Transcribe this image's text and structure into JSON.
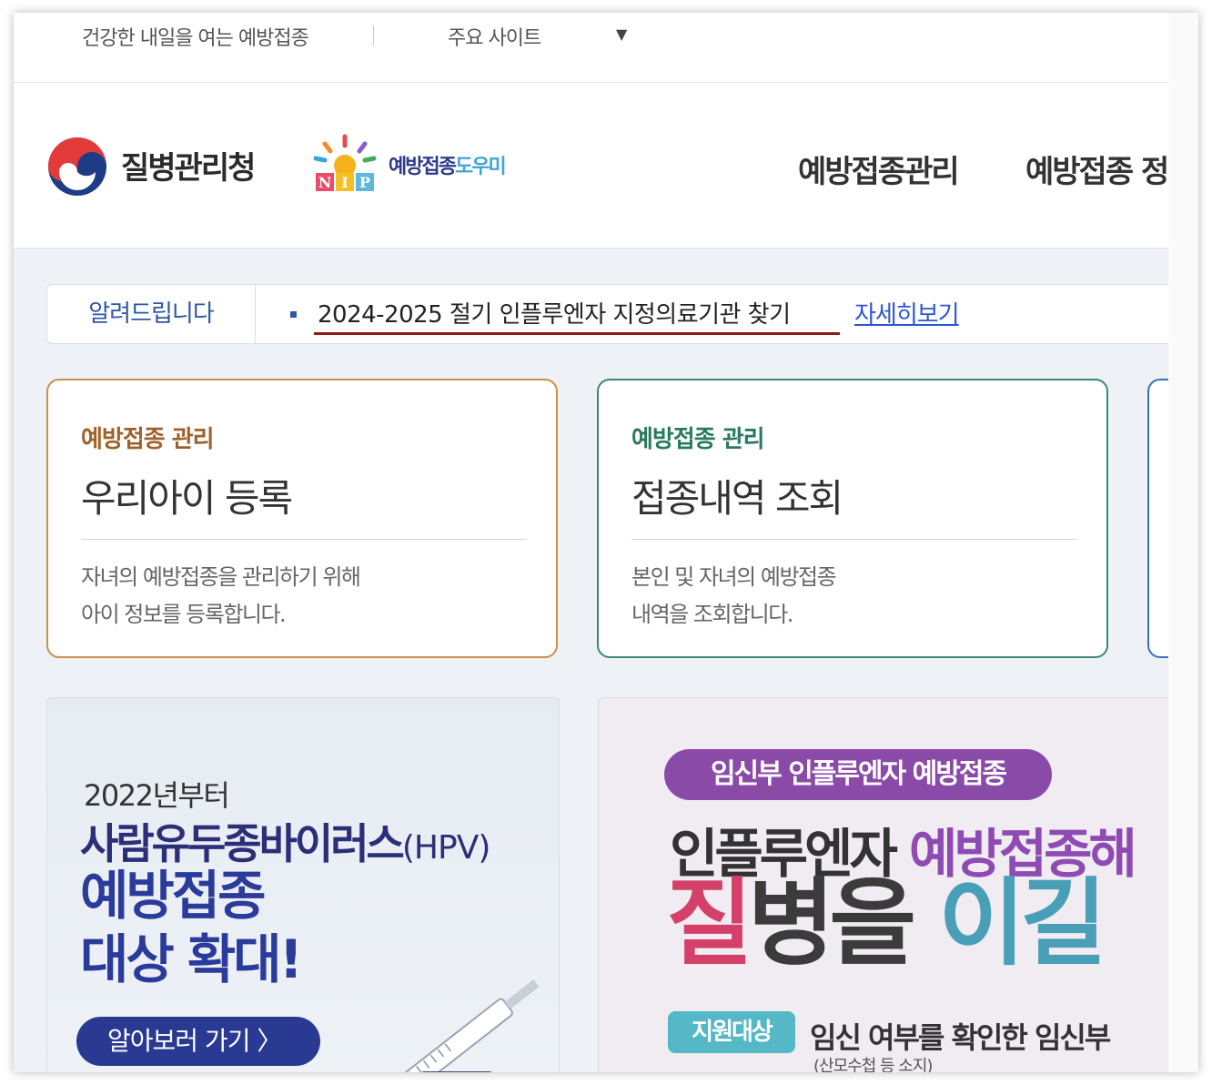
{
  "util": {
    "tagline": "건강한 내일을 여는 예방접종",
    "major_sites": "주요 사이트",
    "dropdown_arrow": "▼"
  },
  "header": {
    "kdca_name": "질병관리청",
    "nip_logo_letters": "NIP",
    "nip_name_a": "예방접종",
    "nip_name_b": "도우미",
    "gnb": [
      "예방접종관리",
      "예방접종 정"
    ]
  },
  "notice": {
    "label": "알려드립니다",
    "text": "2024-2025 절기 인플루엔자 지정의료기관 찾기",
    "more": "자세히보기"
  },
  "cards": [
    {
      "category": "예방접종 관리",
      "title": "우리아이 등록",
      "desc1": "자녀의 예방접종을 관리하기 위해",
      "desc2": "아이 정보를 등록합니다."
    },
    {
      "category": "예방접종 관리",
      "title": "접종내역 조회",
      "desc1": "본인 및 자녀의 예방접종",
      "desc2": "내역을 조회합니다."
    }
  ],
  "banner_hpv": {
    "year": "2022년부터",
    "line1": "사람유두종바이러스",
    "line1_small": "(HPV)",
    "line2": "예방접종",
    "line3": "대상 확대!",
    "button": "알아보러 가기 〉"
  },
  "banner_flu": {
    "pill": "임신부 인플루엔자 예방접종",
    "line1_a": "인플루엔자 ",
    "line1_b": "예방접종",
    "line1_c": "해",
    "line2_a": "질",
    "line2_b": "병을 ",
    "line2_c": "이길",
    "tag": "지원대상",
    "target": "임신 여부를 확인한 임신부",
    "target_sub": "(산모수첩 등 소지)"
  },
  "colors": {
    "brand_blue": "#2d56a6",
    "card1_border": "#c8914a",
    "card2_border": "#3a8a72",
    "hpv_navy": "#2a3a92",
    "flu_purple": "#8a4aa8",
    "flu_pink": "#d4406a",
    "flu_teal": "#4a9fb8"
  }
}
